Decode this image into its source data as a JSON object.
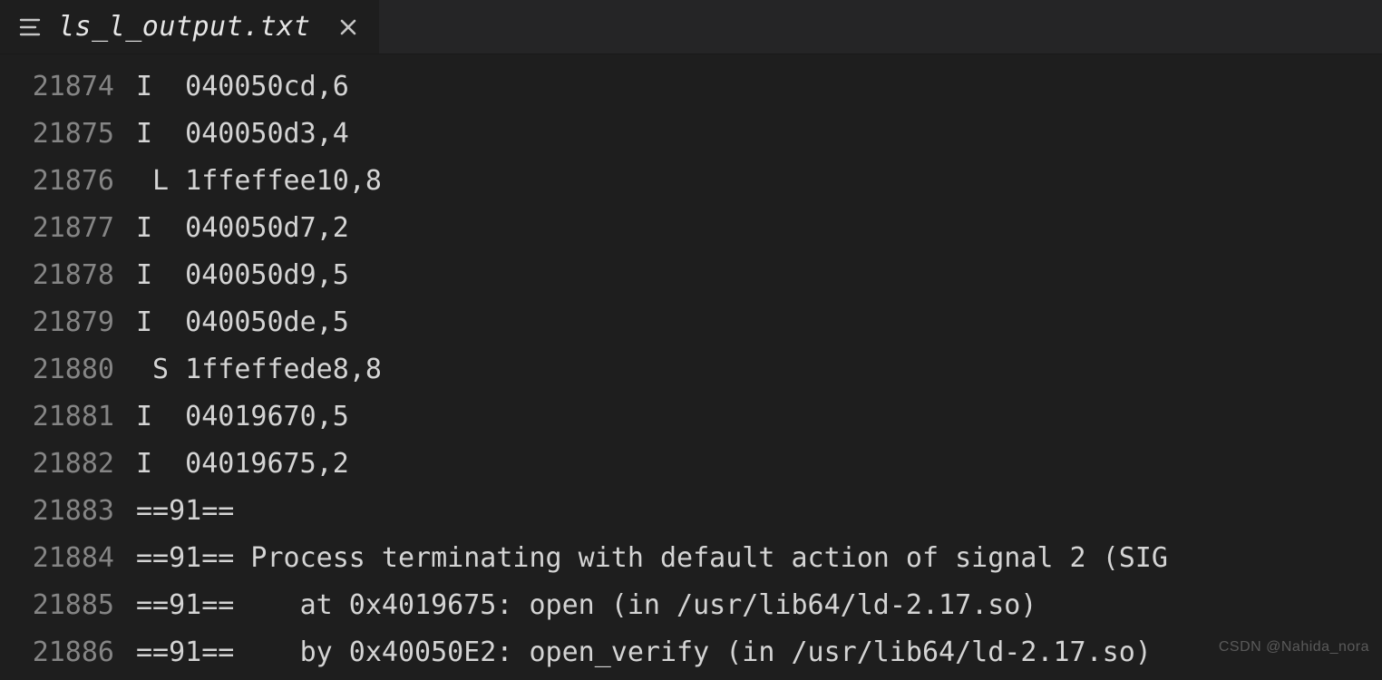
{
  "tab": {
    "filename": "ls_l_output.txt",
    "icon": "text-lines-icon",
    "close_label": "×"
  },
  "editor": {
    "lines": [
      {
        "num": "21874",
        "text": "I  040050cd,6"
      },
      {
        "num": "21875",
        "text": "I  040050d3,4"
      },
      {
        "num": "21876",
        "text": " L 1ffeffee10,8"
      },
      {
        "num": "21877",
        "text": "I  040050d7,2"
      },
      {
        "num": "21878",
        "text": "I  040050d9,5"
      },
      {
        "num": "21879",
        "text": "I  040050de,5"
      },
      {
        "num": "21880",
        "text": " S 1ffeffede8,8"
      },
      {
        "num": "21881",
        "text": "I  04019670,5"
      },
      {
        "num": "21882",
        "text": "I  04019675,2"
      },
      {
        "num": "21883",
        "text": "==91== "
      },
      {
        "num": "21884",
        "text": "==91== Process terminating with default action of signal 2 (SIG"
      },
      {
        "num": "21885",
        "text": "==91==    at 0x4019675: open (in /usr/lib64/ld-2.17.so)"
      },
      {
        "num": "21886",
        "text": "==91==    by 0x40050E2: open_verify (in /usr/lib64/ld-2.17.so)"
      }
    ]
  },
  "watermark": "CSDN @Nahida_nora"
}
